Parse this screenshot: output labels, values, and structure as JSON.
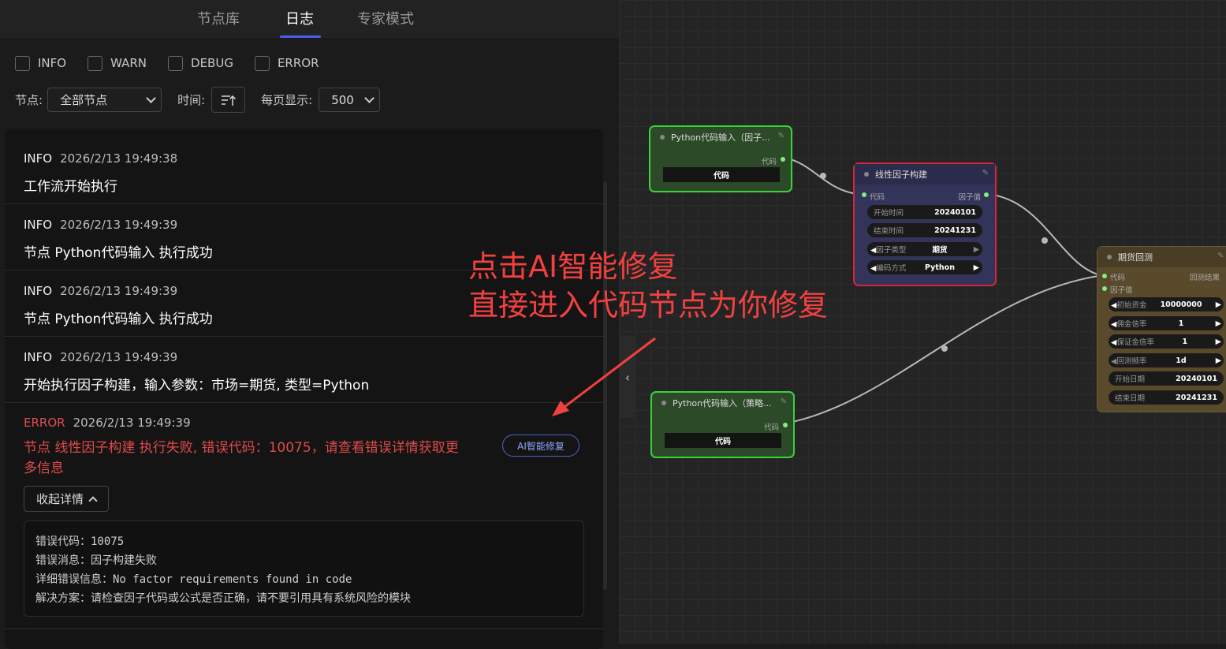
{
  "tabs": [
    "节点库",
    "日志",
    "专家模式"
  ],
  "active_tab": "日志",
  "level_filters": [
    "INFO",
    "WARN",
    "DEBUG",
    "ERROR"
  ],
  "toolbar": {
    "node_label": "节点:",
    "node_value": "全部节点",
    "time_label": "时间:",
    "per_page_label": "每页显示:",
    "per_page_value": "500"
  },
  "logs": [
    {
      "level": "INFO",
      "time": "2026/2/13 19:49:38",
      "message": "工作流开始执行"
    },
    {
      "level": "INFO",
      "time": "2026/2/13 19:49:39",
      "message": "节点 Python代码输入 执行成功"
    },
    {
      "level": "INFO",
      "time": "2026/2/13 19:49:39",
      "message": "节点 Python代码输入 执行成功"
    },
    {
      "level": "INFO",
      "time": "2026/2/13 19:49:39",
      "message": "开始执行因子构建，输入参数：市场=期货, 类型=Python"
    }
  ],
  "error_log": {
    "level": "ERROR",
    "time": "2026/2/13 19:49:39",
    "message": "节点 线性因子构建 执行失败, 错误代码：10075，请查看错误详情获取更多信息",
    "ai_fix_label": "AI智能修复",
    "collapse_label": "收起详情",
    "details": [
      "错误代码：10075",
      "错误消息：因子构建失败",
      "详细错误信息：No factor requirements found in code",
      "解决方案：请检查因子代码或公式是否正确，请不要引用具有系统风险的模块"
    ]
  },
  "annotation": [
    "点击AI智能修复",
    "直接进入代码节点为你修复"
  ],
  "nodes": {
    "code_input_1": {
      "title": "Python代码输入（因子...",
      "out_label": "代码",
      "body_label": "代码"
    },
    "code_input_2": {
      "title": "Python代码输入（策略...",
      "out_label": "代码",
      "body_label": "代码"
    },
    "factor": {
      "title": "线性因子构建",
      "in_label": "代码",
      "out_label": "因子值",
      "fields": [
        {
          "k": "开始时间",
          "v": "20240101"
        },
        {
          "k": "结束时间",
          "v": "20241231"
        },
        {
          "k": "因子类型",
          "v": "期货"
        },
        {
          "k": "编码方式",
          "v": "Python"
        }
      ]
    },
    "backtest": {
      "title": "期货回测",
      "in1": "代码",
      "in2": "因子值",
      "out_label": "回测结果",
      "fields": [
        {
          "k": "初始资金",
          "v": "10000000"
        },
        {
          "k": "佣金信率",
          "v": "1"
        },
        {
          "k": "保证金信率",
          "v": "1"
        },
        {
          "k": "回测频率",
          "v": "1d"
        },
        {
          "k": "开始日期",
          "v": "20240101"
        },
        {
          "k": "结束日期",
          "v": "20241231"
        }
      ]
    }
  },
  "colors": {
    "error": "#e14a4a",
    "accent": "#4b5cf0",
    "annotation": "#f24040"
  }
}
